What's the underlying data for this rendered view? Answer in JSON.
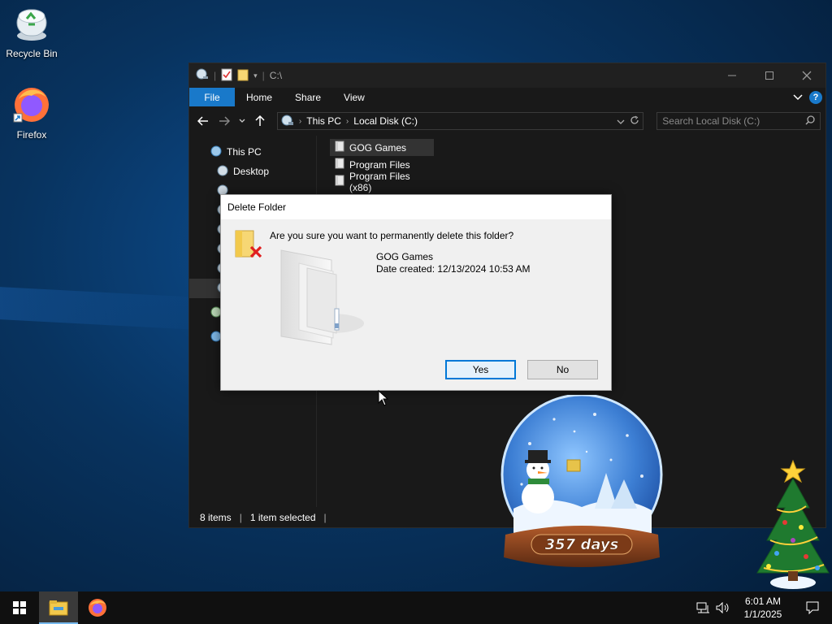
{
  "desktop": {
    "icons": [
      {
        "label": "Recycle Bin",
        "icon": "recycle-bin-icon"
      },
      {
        "label": "Firefox",
        "icon": "firefox-icon"
      }
    ]
  },
  "explorer": {
    "title": "C:\\",
    "ribbon_tabs": [
      "File",
      "Home",
      "Share",
      "View"
    ],
    "help": "?",
    "address": {
      "crumbs": [
        "This PC",
        "Local Disk (C:)"
      ]
    },
    "search": {
      "placeholder": "Search Local Disk (C:)"
    },
    "nav": [
      {
        "label": "This PC",
        "icon": "this-pc-icon"
      },
      {
        "label": "Desktop",
        "icon": "desktop-icon"
      }
    ],
    "files": [
      {
        "name": "GOG Games",
        "selected": true
      },
      {
        "name": "Program Files",
        "selected": false
      },
      {
        "name": "Program Files (x86)",
        "selected": false
      }
    ],
    "status": {
      "items": "8 items",
      "selected": "1 item selected"
    }
  },
  "dialog": {
    "title": "Delete Folder",
    "question": "Are you sure you want to permanently delete this folder?",
    "folder_name": "GOG Games",
    "date_created": "Date created: 12/13/2024 10:53 AM",
    "yes": "Yes",
    "no": "No"
  },
  "widget": {
    "days": "357 days"
  },
  "taskbar": {
    "time": "6:01 AM",
    "date": "1/1/2025"
  },
  "colors": {
    "accent": "#1979ca",
    "explorer_bg": "#191919",
    "dialog_bg": "#f0f0f0"
  }
}
